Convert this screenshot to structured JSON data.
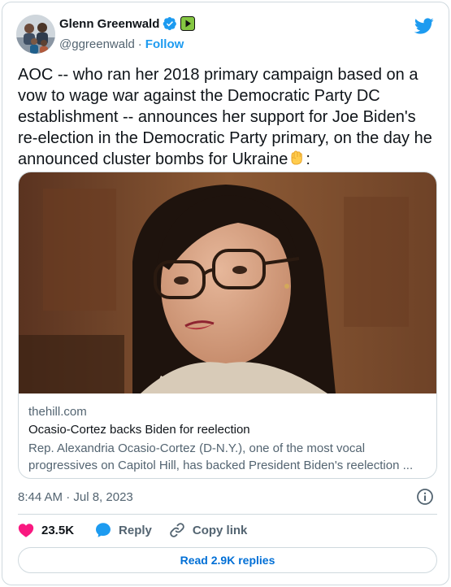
{
  "author": {
    "name": "Glenn Greenwald",
    "handle": "@ggreenwald",
    "separator": "·",
    "follow_label": "Follow"
  },
  "tweet": {
    "text_before_emoji": "AOC -- who ran her 2018 primary campaign based on a vow to wage war against the Democratic Party DC establishment -- announces her support for Joe Biden's re-election in the Democratic Party primary, on the day he announced cluster bombs for Ukraine",
    "text_after_emoji": ":",
    "emoji": "raised-fist"
  },
  "link_card": {
    "domain": "thehill.com",
    "title": "Ocasio-Cortez backs Biden for reelection",
    "description": "Rep. Alexandria Ocasio-Cortez (D-N.Y.), one of the most vocal progressives on Capitol Hill, has backed President Biden's reelection ..."
  },
  "timestamp": "8:44 AM · Jul 8, 2023",
  "actions": {
    "like_count": "23.5K",
    "reply_label": "Reply",
    "copy_label": "Copy link"
  },
  "read_replies_label": "Read 2.9K replies",
  "colors": {
    "accent": "#1d9bf0",
    "like": "#f91880",
    "muted": "#536471",
    "link_button": "#006fd6"
  },
  "icons": [
    "twitter-bird-icon",
    "verified-badge-icon",
    "rumble-badge-icon",
    "raised-fist-emoji",
    "info-icon",
    "heart-icon",
    "reply-bubble-icon",
    "link-icon"
  ]
}
